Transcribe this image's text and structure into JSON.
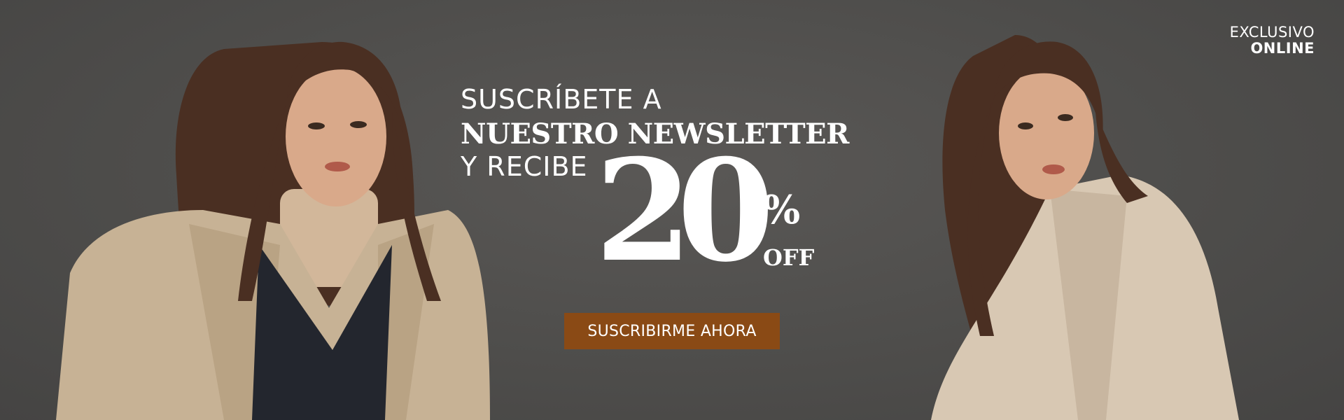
{
  "badge": {
    "line1": "EXCLUSIVO",
    "line2": "ONLINE"
  },
  "headline": {
    "line1": "SUSCRÍBETE A",
    "line2": "NUESTRO NEWSLETTER",
    "line3": "Y RECIBE",
    "discount_number": "20",
    "percent_sign": "%",
    "off_label": "OFF"
  },
  "cta": {
    "label": "SUSCRIBIRME AHORA"
  },
  "colors": {
    "background": "#4e4d4b",
    "cta_background": "#8a4a15",
    "text": "#ffffff",
    "coat": "#c8b49a",
    "hair": "#4a2f22"
  }
}
